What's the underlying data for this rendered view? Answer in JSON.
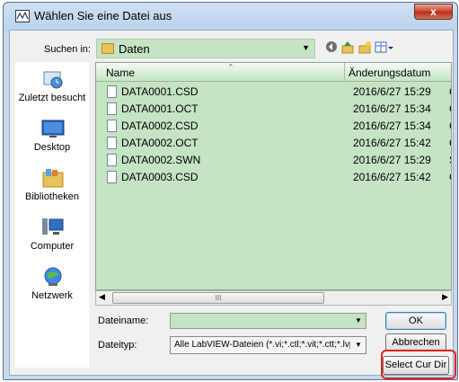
{
  "window": {
    "title": "Wählen Sie eine Datei aus",
    "close_label": "x"
  },
  "lookin": {
    "label": "Suchen in:",
    "value": "Daten",
    "arrow": "▼"
  },
  "toolbar": {
    "back_icon": "back-icon",
    "up_icon": "up-folder-icon",
    "newfolder_icon": "new-folder-icon",
    "views_icon": "views-icon"
  },
  "places": [
    {
      "label": "Zuletzt besucht",
      "icon": "recent-places-icon"
    },
    {
      "label": "Desktop",
      "icon": "desktop-icon"
    },
    {
      "label": "Bibliotheken",
      "icon": "libraries-icon"
    },
    {
      "label": "Computer",
      "icon": "computer-icon"
    },
    {
      "label": "Netzwerk",
      "icon": "network-icon"
    }
  ],
  "list": {
    "headers": {
      "name": "Name",
      "date": "Änderungsdatum",
      "sort_glyph": "^"
    },
    "rows": [
      {
        "name": "DATA0001.CSD",
        "date": "2016/6/27 15:29",
        "extra": "C"
      },
      {
        "name": "DATA0001.OCT",
        "date": "2016/6/27 15:34",
        "extra": "C"
      },
      {
        "name": "DATA0002.CSD",
        "date": "2016/6/27 15:34",
        "extra": "C"
      },
      {
        "name": "DATA0002.OCT",
        "date": "2016/6/27 15:42",
        "extra": "C"
      },
      {
        "name": "DATA0002.SWN",
        "date": "2016/6/27 15:29",
        "extra": "S"
      },
      {
        "name": "DATA0003.CSD",
        "date": "2016/6/27 15:42",
        "extra": "C"
      }
    ]
  },
  "scroll": {
    "left": "◀",
    "thumb": "III",
    "right": "▶"
  },
  "filename": {
    "label": "Dateiname:",
    "value": "",
    "arrow": "▼"
  },
  "filetype": {
    "label": "Dateityp:",
    "value": "Alle LabVIEW-Dateien (*.vi;*.ctl;*.vit;*.ctt;*.lvprc",
    "arrow": "▼"
  },
  "buttons": {
    "ok": "OK",
    "cancel": "Abbrechen",
    "select_cur_dir": "Select Cur Dir"
  },
  "colors": {
    "list_bg": "#c4e4c4",
    "highlight": "#e02020",
    "folder": "#e8c25a"
  }
}
